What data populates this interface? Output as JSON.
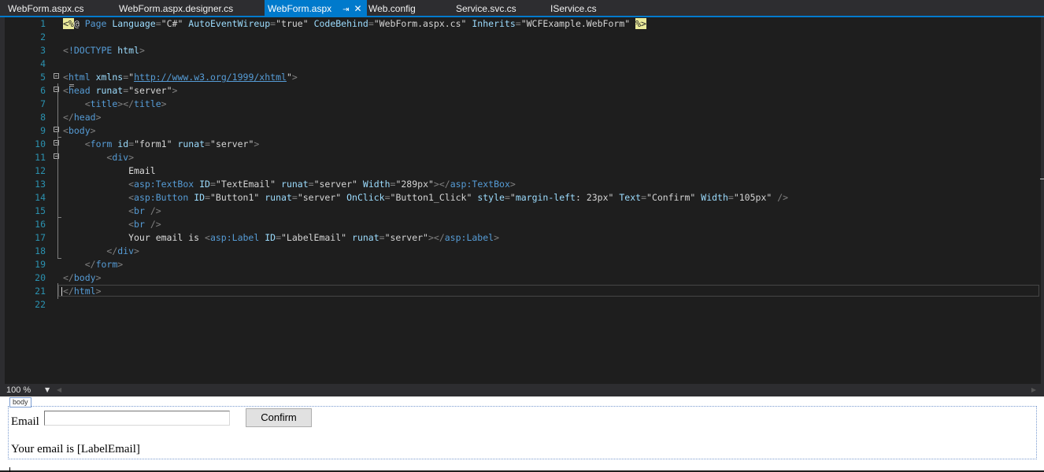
{
  "tabs": [
    {
      "label": "WebForm.aspx.cs",
      "active": false
    },
    {
      "label": "WebForm.aspx.designer.cs",
      "active": false
    },
    {
      "label": "WebForm.aspx",
      "active": true
    },
    {
      "label": "Web.config",
      "active": false
    },
    {
      "label": "Service.svc.cs",
      "active": false
    },
    {
      "label": "IService.cs",
      "active": false
    }
  ],
  "tab_icons": {
    "pin": "pin-icon",
    "close": "close-icon"
  },
  "editor": {
    "line_numbers": [
      "1",
      "2",
      "3",
      "4",
      "5",
      "6",
      "7",
      "8",
      "9",
      "10",
      "11",
      "12",
      "13",
      "14",
      "15",
      "16",
      "17",
      "18",
      "19",
      "20",
      "21",
      "22"
    ],
    "lines": [
      [
        [
          "delim",
          "<%"
        ],
        [
          "text",
          "@ "
        ],
        [
          "tag",
          "Page "
        ],
        [
          "attr",
          "Language"
        ],
        [
          "bracket",
          "="
        ],
        [
          "val",
          "\"C#\" "
        ],
        [
          "attr",
          "AutoEventWireup"
        ],
        [
          "bracket",
          "="
        ],
        [
          "val",
          "\"true\" "
        ],
        [
          "attr",
          "CodeBehind"
        ],
        [
          "bracket",
          "="
        ],
        [
          "val",
          "\"WebForm.aspx.cs\" "
        ],
        [
          "attr",
          "Inherits"
        ],
        [
          "bracket",
          "="
        ],
        [
          "val",
          "\"WCFExample.WebForm\" "
        ],
        [
          "delim",
          "%>"
        ]
      ],
      [],
      [
        [
          "bracket",
          "<"
        ],
        [
          "tag",
          "!DOCTYPE "
        ],
        [
          "attr",
          "html"
        ],
        [
          "bracket",
          ">"
        ]
      ],
      [],
      [
        [
          "bracket",
          "<"
        ],
        [
          "tag",
          "html "
        ],
        [
          "attr",
          "xmlns"
        ],
        [
          "bracket",
          "="
        ],
        [
          "val",
          "\""
        ],
        [
          "link",
          "http://www.w3.org/1999/xhtml"
        ],
        [
          "val",
          "\""
        ],
        [
          "bracket",
          ">"
        ]
      ],
      [
        [
          "bracket",
          "<"
        ],
        [
          "tag",
          "head "
        ],
        [
          "attr",
          "runat"
        ],
        [
          "bracket",
          "="
        ],
        [
          "val",
          "\"server\""
        ],
        [
          "bracket",
          ">"
        ]
      ],
      [
        [
          "text",
          "    "
        ],
        [
          "bracket",
          "<"
        ],
        [
          "tag",
          "title"
        ],
        [
          "bracket",
          "></"
        ],
        [
          "tag",
          "title"
        ],
        [
          "bracket",
          ">"
        ]
      ],
      [
        [
          "bracket",
          "</"
        ],
        [
          "tag",
          "head"
        ],
        [
          "bracket",
          ">"
        ]
      ],
      [
        [
          "bracket",
          "<"
        ],
        [
          "tag",
          "body"
        ],
        [
          "bracket",
          ">"
        ]
      ],
      [
        [
          "text",
          "    "
        ],
        [
          "bracket",
          "<"
        ],
        [
          "tag",
          "form "
        ],
        [
          "attr",
          "id"
        ],
        [
          "bracket",
          "="
        ],
        [
          "val",
          "\"form1\" "
        ],
        [
          "attr",
          "runat"
        ],
        [
          "bracket",
          "="
        ],
        [
          "val",
          "\"server\""
        ],
        [
          "bracket",
          ">"
        ]
      ],
      [
        [
          "text",
          "        "
        ],
        [
          "bracket",
          "<"
        ],
        [
          "tag",
          "div"
        ],
        [
          "bracket",
          ">"
        ]
      ],
      [
        [
          "text",
          "            Email"
        ]
      ],
      [
        [
          "text",
          "            "
        ],
        [
          "bracket",
          "<"
        ],
        [
          "tag",
          "asp:TextBox "
        ],
        [
          "attr",
          "ID"
        ],
        [
          "bracket",
          "="
        ],
        [
          "val",
          "\"TextEmail\" "
        ],
        [
          "attr",
          "runat"
        ],
        [
          "bracket",
          "="
        ],
        [
          "val",
          "\"server\" "
        ],
        [
          "attr",
          "Width"
        ],
        [
          "bracket",
          "="
        ],
        [
          "val",
          "\"289px\""
        ],
        [
          "bracket",
          "></"
        ],
        [
          "tag",
          "asp:TextBox"
        ],
        [
          "bracket",
          ">"
        ]
      ],
      [
        [
          "text",
          "            "
        ],
        [
          "bracket",
          "<"
        ],
        [
          "tag",
          "asp:Button "
        ],
        [
          "attr",
          "ID"
        ],
        [
          "bracket",
          "="
        ],
        [
          "val",
          "\"Button1\" "
        ],
        [
          "attr",
          "runat"
        ],
        [
          "bracket",
          "="
        ],
        [
          "val",
          "\"server\" "
        ],
        [
          "attr",
          "OnClick"
        ],
        [
          "bracket",
          "="
        ],
        [
          "val",
          "\"Button1_Click\" "
        ],
        [
          "attr",
          "style"
        ],
        [
          "bracket",
          "="
        ],
        [
          "val",
          "\""
        ],
        [
          "attr",
          "margin-left"
        ],
        [
          "val",
          ": 23px\" "
        ],
        [
          "attr",
          "Text"
        ],
        [
          "bracket",
          "="
        ],
        [
          "val",
          "\"Confirm\" "
        ],
        [
          "attr",
          "Width"
        ],
        [
          "bracket",
          "="
        ],
        [
          "val",
          "\"105px\" "
        ],
        [
          "bracket",
          "/>"
        ]
      ],
      [
        [
          "text",
          "            "
        ],
        [
          "bracket",
          "<"
        ],
        [
          "tag",
          "br "
        ],
        [
          "bracket",
          "/>"
        ]
      ],
      [
        [
          "text",
          "            "
        ],
        [
          "bracket",
          "<"
        ],
        [
          "tag",
          "br "
        ],
        [
          "bracket",
          "/>"
        ]
      ],
      [
        [
          "text",
          "            Your email is "
        ],
        [
          "bracket",
          "<"
        ],
        [
          "tag",
          "asp:Label "
        ],
        [
          "attr",
          "ID"
        ],
        [
          "bracket",
          "="
        ],
        [
          "val",
          "\"LabelEmail\" "
        ],
        [
          "attr",
          "runat"
        ],
        [
          "bracket",
          "="
        ],
        [
          "val",
          "\"server\""
        ],
        [
          "bracket",
          "></"
        ],
        [
          "tag",
          "asp:Label"
        ],
        [
          "bracket",
          ">"
        ]
      ],
      [
        [
          "text",
          "        "
        ],
        [
          "bracket",
          "</"
        ],
        [
          "tag",
          "div"
        ],
        [
          "bracket",
          ">"
        ]
      ],
      [
        [
          "text",
          "    "
        ],
        [
          "bracket",
          "</"
        ],
        [
          "tag",
          "form"
        ],
        [
          "bracket",
          ">"
        ]
      ],
      [
        [
          "bracket",
          "</"
        ],
        [
          "tag",
          "body"
        ],
        [
          "bracket",
          ">"
        ]
      ],
      [
        [
          "bracket",
          "</"
        ],
        [
          "tag",
          "html"
        ],
        [
          "bracket",
          ">"
        ]
      ],
      []
    ],
    "fold_lines": [
      5,
      6,
      9,
      10,
      11
    ],
    "current_line": 21
  },
  "zoom": {
    "value": "100 %"
  },
  "design": {
    "body_tag": "body",
    "email_label": "Email",
    "email_input_value": "",
    "confirm_label": "Confirm",
    "result_text": "Your email is [LabelEmail]"
  },
  "colors": {
    "accent": "#007acc",
    "editor_bg": "#1e1e1e",
    "line_number": "#2b91af",
    "tag": "#569cd6",
    "attribute": "#9cdcfe"
  }
}
